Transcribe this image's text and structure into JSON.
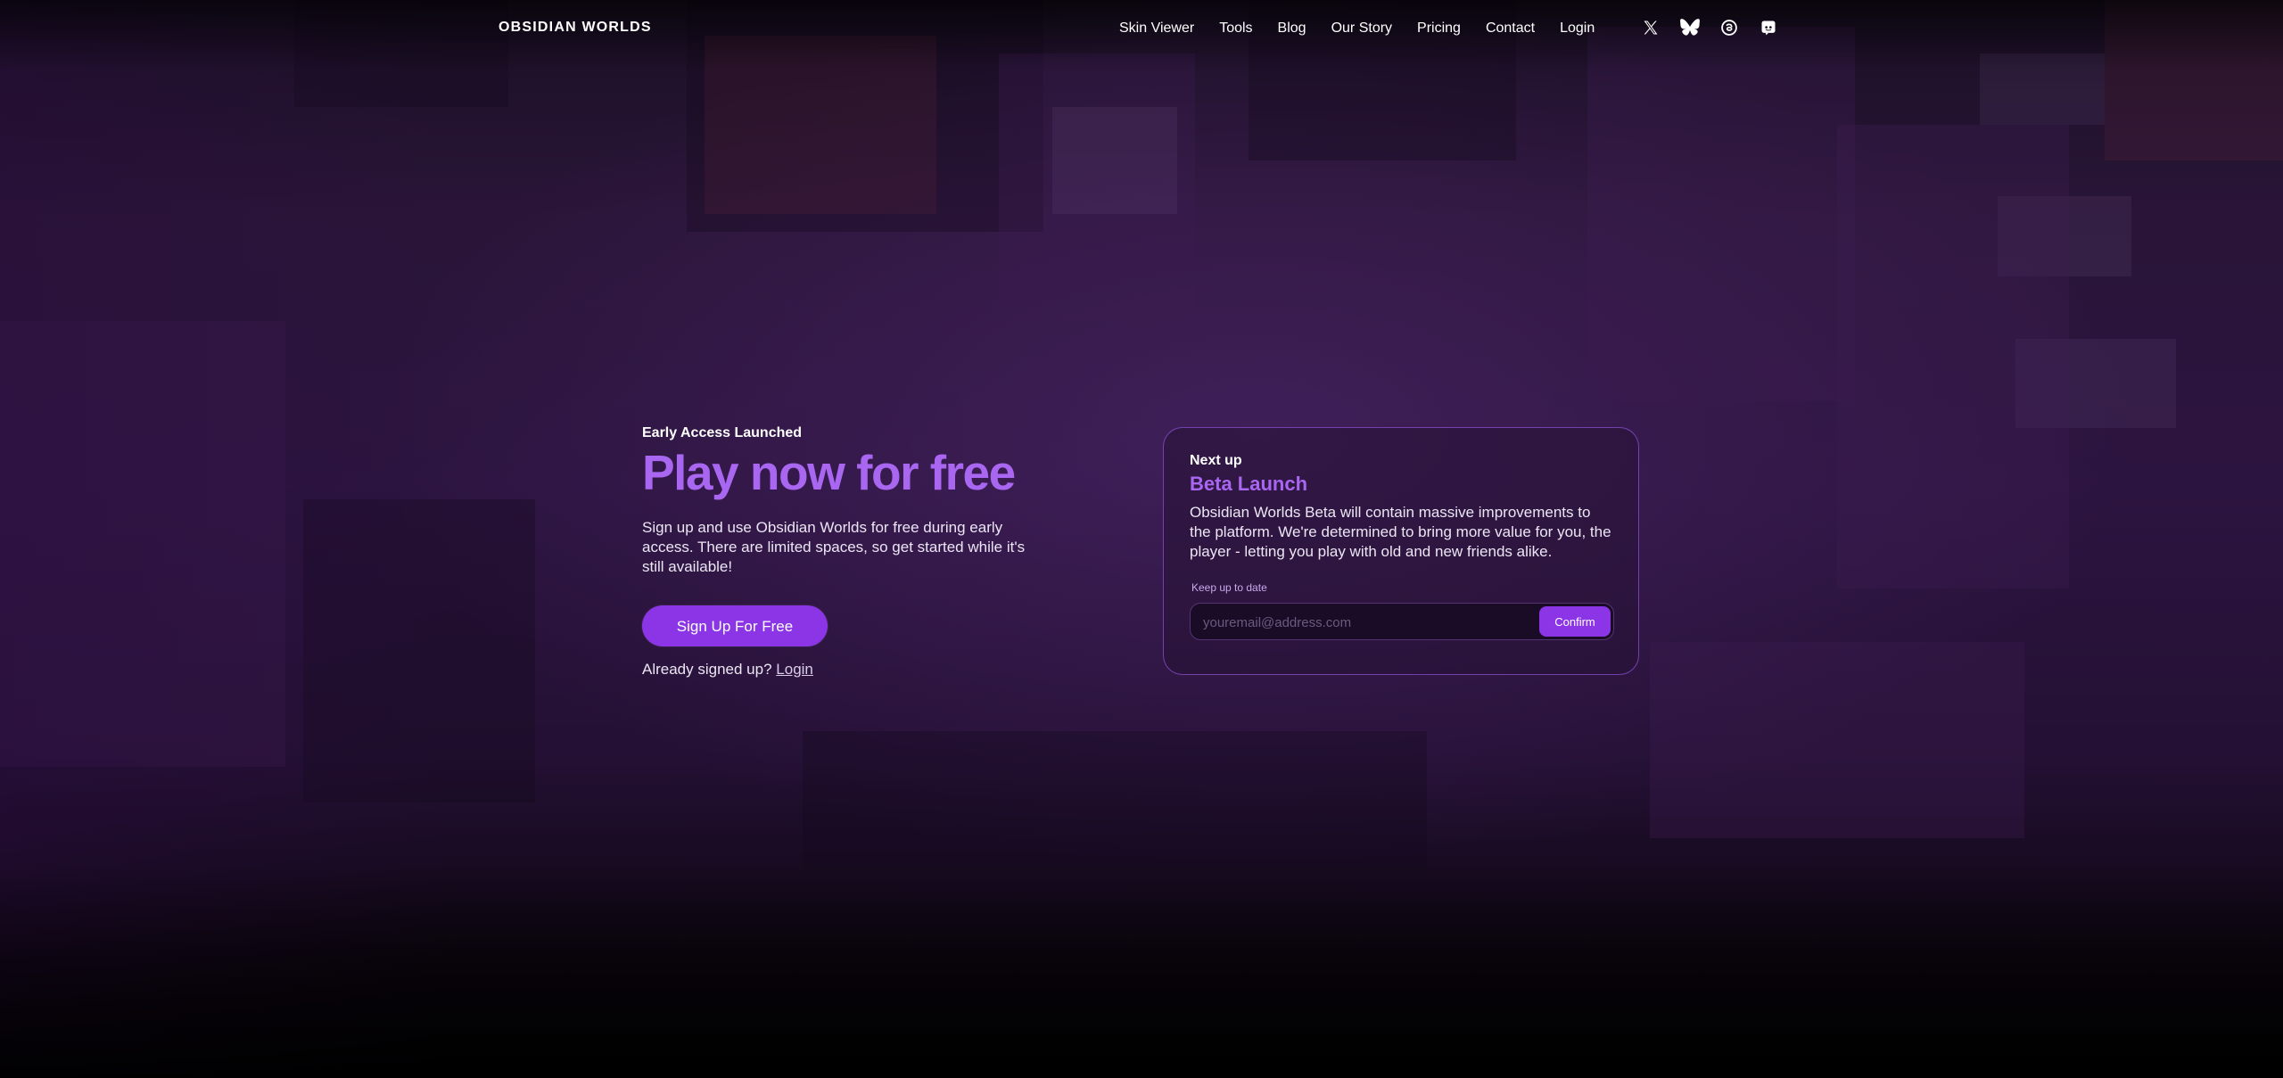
{
  "nav": {
    "logo": "OBSIDIAN WORLDS",
    "links": [
      "Skin Viewer",
      "Tools",
      "Blog",
      "Our Story",
      "Pricing",
      "Contact",
      "Login"
    ],
    "socials": [
      "x-icon",
      "bluesky-icon",
      "threads-icon",
      "discord-icon"
    ]
  },
  "hero": {
    "eyebrow": "Early Access Launched",
    "headline": "Play now for free",
    "description": "Sign up and use Obsidian Worlds for free during early access. There are limited spaces, so get started while it's still available!",
    "cta_label": "Sign Up For Free",
    "already_text": "Already signed up?",
    "login_link": "Login"
  },
  "card": {
    "kicker": "Next up",
    "title": "Beta Launch",
    "body": "Obsidian Worlds Beta will contain massive improvements to the platform. We're determined to bring more value for you, the player - letting you play with old and new friends alike.",
    "keep_label": "Keep up to date",
    "email_placeholder": "youremail@address.com",
    "email_value": "",
    "confirm_label": "Confirm"
  },
  "colors": {
    "accent": "#8b35e6",
    "headline": "#a966f0",
    "card_border": "#8c50d2"
  }
}
